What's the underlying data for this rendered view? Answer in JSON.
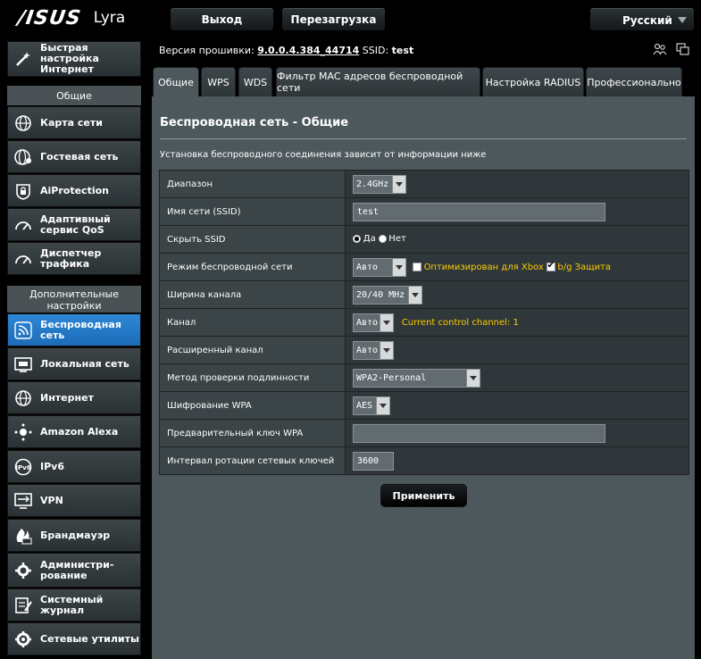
{
  "header": {
    "brand": "/ISUS",
    "model": "Lyra",
    "logout_label": "Выход",
    "reboot_label": "Перезагрузка",
    "language": "Русский"
  },
  "info": {
    "firmware_label": "Версия прошивки:",
    "firmware_value": "9.0.0.4.384_44714",
    "ssid_label": "SSID:",
    "ssid_value": "test"
  },
  "sidebar": {
    "quick_setup": "Быстрая настройка Интернет",
    "section_general": "Общие",
    "general_items": [
      {
        "label": "Карта сети",
        "icon": "globe-icon"
      },
      {
        "label": "Гостевая сеть",
        "icon": "guest-network-icon"
      },
      {
        "label": "AiProtection",
        "icon": "lock-icon"
      },
      {
        "label": "Адаптивный сервис QoS",
        "icon": "gauge-icon"
      },
      {
        "label": "Диспетчер трафика",
        "icon": "gauge-icon"
      }
    ],
    "section_advanced": "Дополнительные настройки",
    "advanced_items": [
      {
        "label": "Беспроводная сеть",
        "icon": "wifi-icon",
        "active": true
      },
      {
        "label": "Локальная сеть",
        "icon": "lan-icon"
      },
      {
        "label": "Интернет",
        "icon": "globe-icon"
      },
      {
        "label": "Amazon Alexa",
        "icon": "alexa-icon"
      },
      {
        "label": "IPv6",
        "icon": "ipv6-icon"
      },
      {
        "label": "VPN",
        "icon": "vpn-icon"
      },
      {
        "label": "Брандмауэр",
        "icon": "firewall-icon"
      },
      {
        "label": "Администри-рование",
        "icon": "gear-icon"
      },
      {
        "label": "Системный журнал",
        "icon": "log-icon"
      },
      {
        "label": "Сетевые утилиты",
        "icon": "tools-icon"
      }
    ]
  },
  "tabs": [
    "Общие",
    "WPS",
    "WDS",
    "Фильтр MAC адресов беспроводной сети",
    "Настройка RADIUS",
    "Профессионально"
  ],
  "main": {
    "title": "Беспроводная сеть - Общие",
    "description": "Установка беспроводного соединения зависит от информации ниже",
    "fields": {
      "band_label": "Диапазон",
      "band_value": "2.4GHz",
      "ssid_label": "Имя сети (SSID)",
      "ssid_value": "test",
      "hide_label": "Скрыть SSID",
      "hide_yes": "Да",
      "hide_no": "Нет",
      "mode_label": "Режим беспроводной сети",
      "mode_value": "Авто",
      "xbox_label": "Оптимизирован для Xbox",
      "bg_label": "b/g Защита",
      "width_label": "Ширина канала",
      "width_value": "20/40 MHz",
      "channel_label": "Канал",
      "channel_value": "Авто",
      "channel_info": "Current control channel: 1",
      "ext_label": "Расширенный канал",
      "ext_value": "Авто",
      "auth_label": "Метод проверки подлинности",
      "auth_value": "WPA2-Personal",
      "enc_label": "Шифрование WPA",
      "enc_value": "AES",
      "key_label": "Предварительный ключ WPA",
      "key_value": "",
      "interval_label": "Интервал ротации сетевых ключей",
      "interval_value": "3600"
    },
    "apply_label": "Применить"
  }
}
